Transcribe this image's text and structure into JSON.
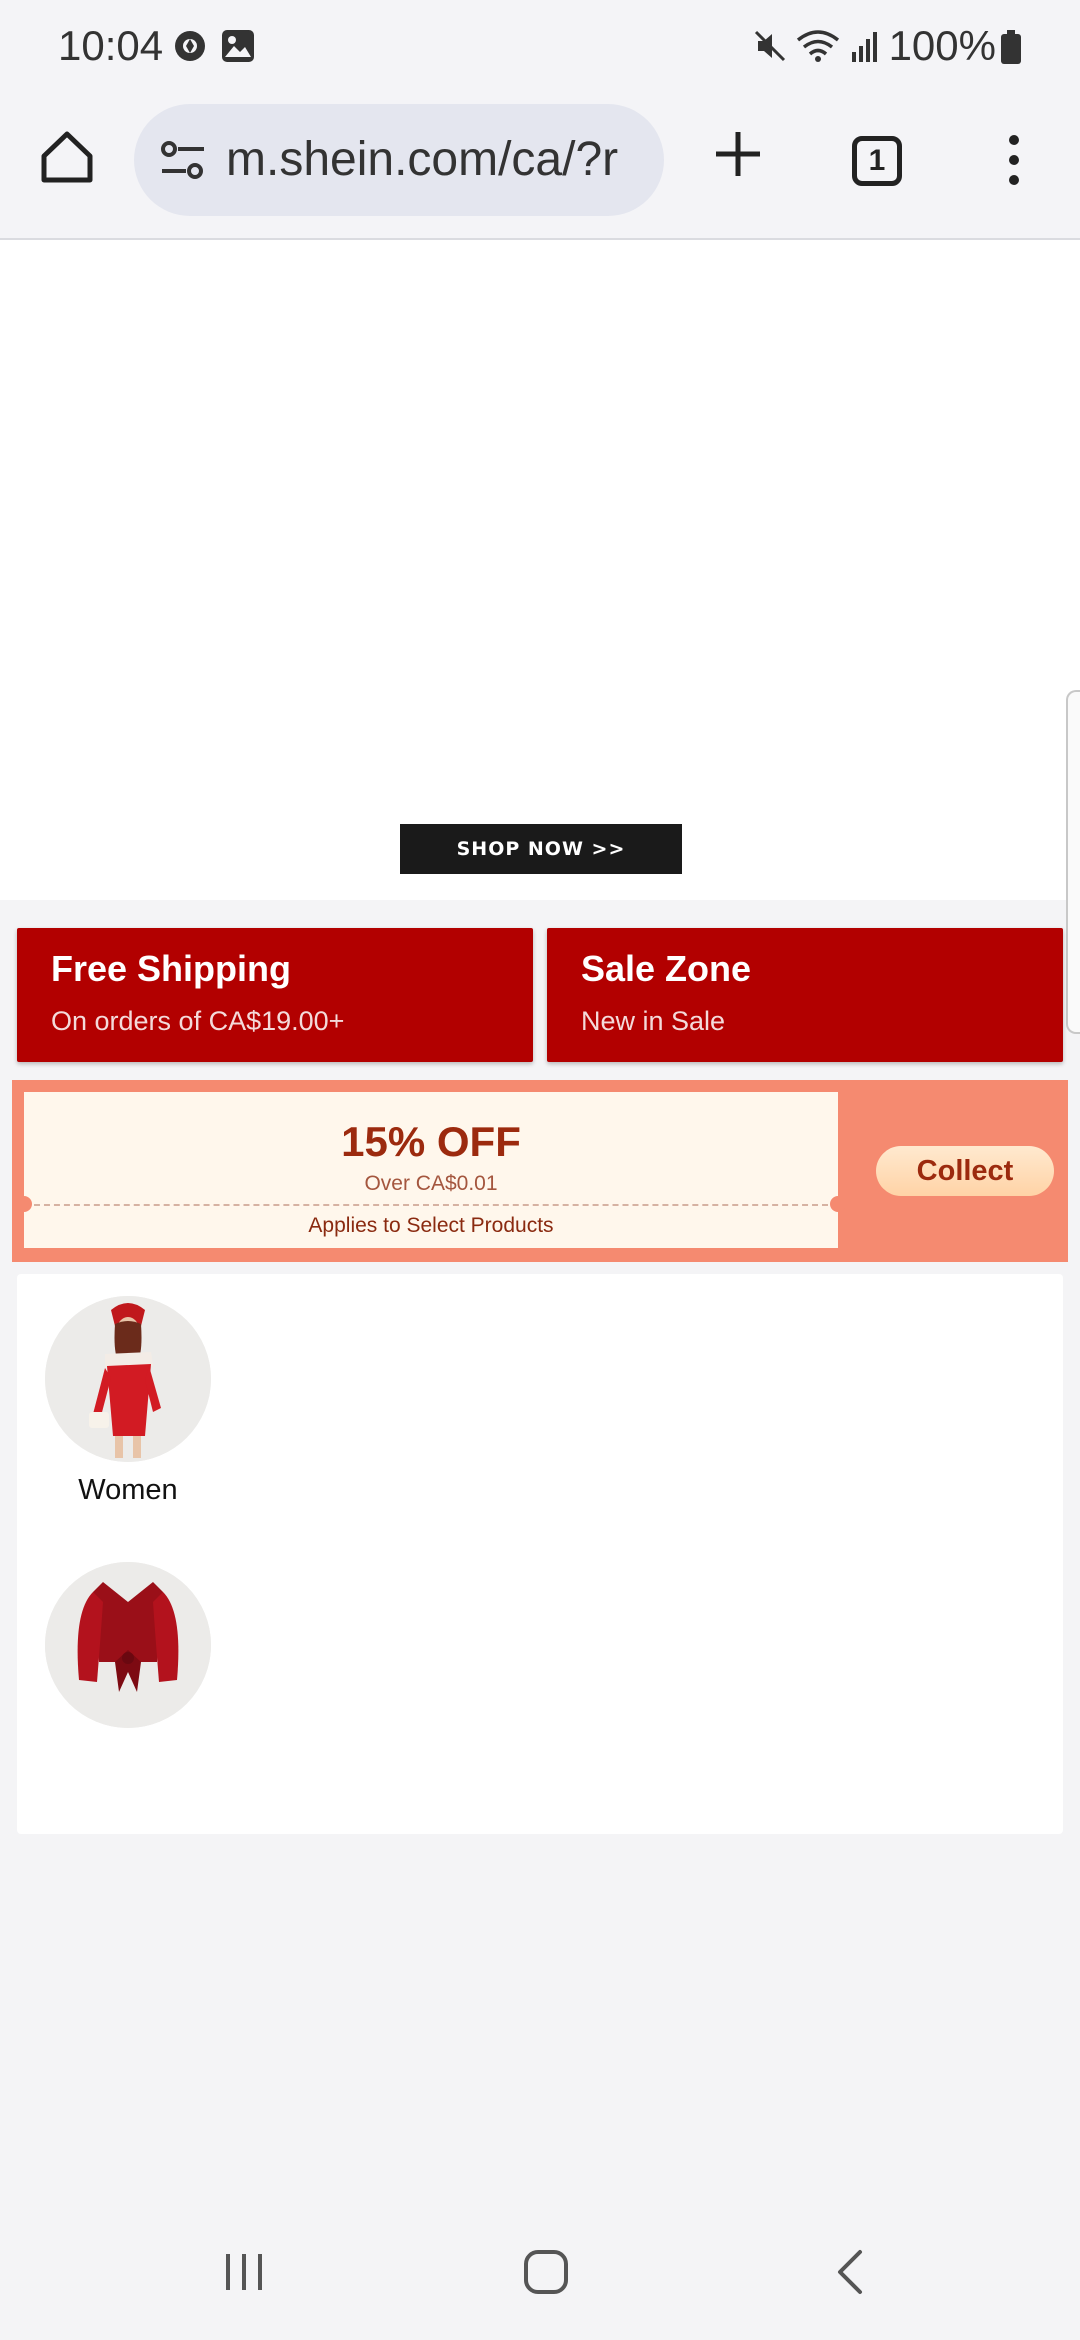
{
  "status_bar": {
    "time": "10:04",
    "battery": "100%",
    "icons": [
      "sync-icon",
      "image-icon",
      "mute-icon",
      "wifi-icon",
      "signal-icon",
      "battery-icon"
    ]
  },
  "browser": {
    "url": "m.shein.com/ca/?r",
    "tab_count": "1"
  },
  "hero": {
    "cta_label": "SHOP NOW >>"
  },
  "promos": [
    {
      "title": "Free Shipping",
      "subtitle": "On orders of CA$19.00+"
    },
    {
      "title": "Sale Zone",
      "subtitle": "New in Sale"
    }
  ],
  "coupon": {
    "discount": "15% OFF",
    "threshold": "Over CA$0.01",
    "scope": "Applies to Select Products",
    "button": "Collect"
  },
  "categories": [
    {
      "label": "Women"
    },
    {
      "label": ""
    }
  ],
  "colors": {
    "promo_red": "#b20000",
    "coupon_strip": "#f58a70",
    "coupon_text": "#9c2a0e",
    "page_bg": "#f4f4f6"
  }
}
